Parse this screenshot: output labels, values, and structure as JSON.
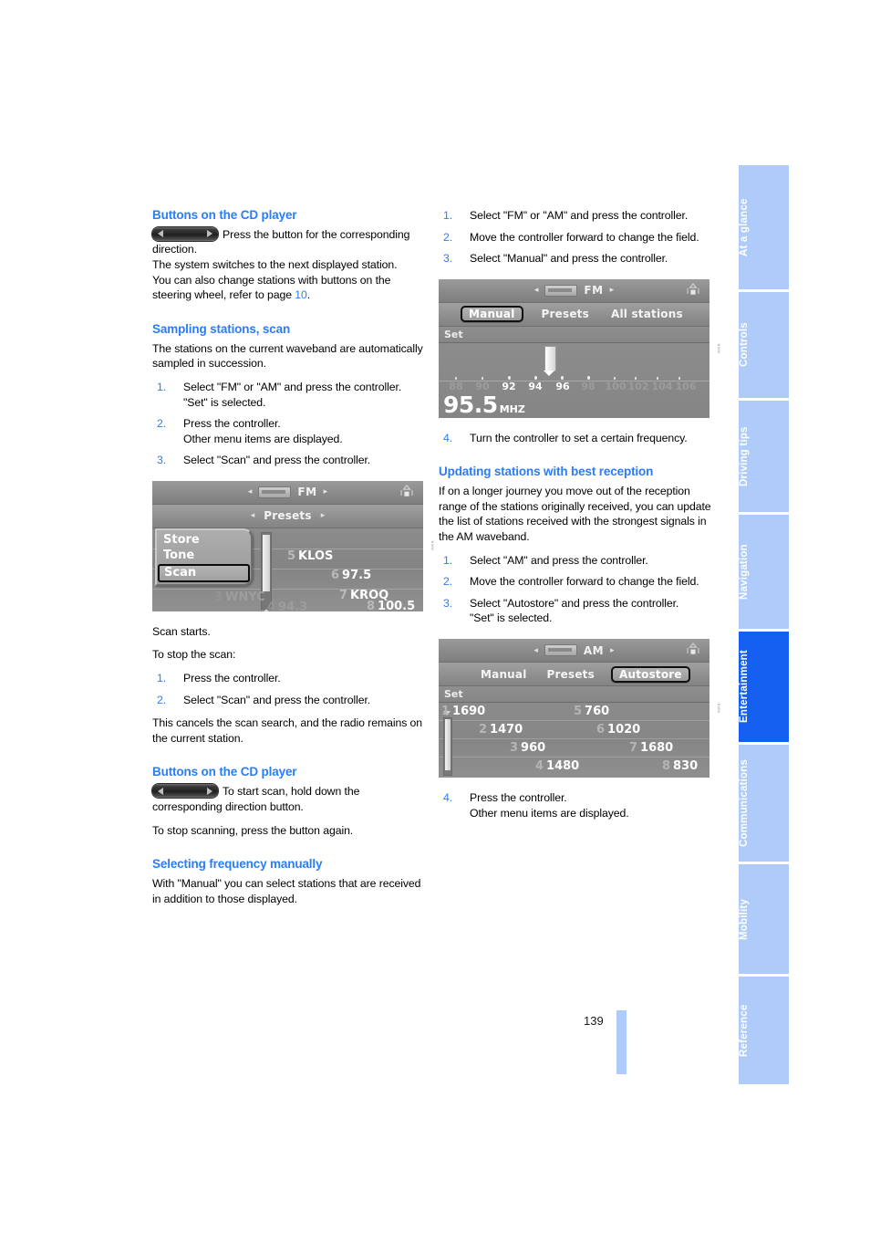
{
  "page": {
    "number": "139",
    "accent_blue": "#2b7df6",
    "tab_blue": "#aecbfa",
    "tab_active_blue": "#1560f0"
  },
  "left_column": {
    "sections": [
      {
        "heading": "Buttons on the CD player",
        "icon": "rocker-button-icon",
        "icon_text": "Press the button for the corresponding direction.",
        "paragraphs": [
          "The system switches to the next displayed station.",
          "You can also change stations with buttons on the steering wheel, refer to page "
        ],
        "page_ref": "10",
        "page_ref_suffix": "."
      },
      {
        "heading": "Sampling stations, scan",
        "intro": "The stations on the current waveband are automatically sampled in succession.",
        "steps": [
          {
            "num": "1.",
            "text": "Select \"FM\" or \"AM\" and press the controller.",
            "sub": "\"Set\" is selected."
          },
          {
            "num": "2.",
            "text": "Press the controller.",
            "sub": "Other menu items are displayed."
          },
          {
            "num": "3.",
            "text": "Select \"Scan\" and press the controller.",
            "sub": ""
          }
        ],
        "after": [
          "Scan starts.",
          "To stop the scan:"
        ],
        "steps2": [
          {
            "num": "1.",
            "text": "Press the controller.",
            "sub": ""
          },
          {
            "num": "2.",
            "text": "Select \"Scan\" and press the controller.",
            "sub": ""
          }
        ],
        "closing": "This cancels the scan search, and the radio remains on the current station."
      },
      {
        "heading": "Buttons on the CD player",
        "icon": "rocker-button-icon",
        "icon_text": "To start scan, hold down the corresponding direction button.",
        "paragraphs": [
          "To stop scanning, press the button again."
        ]
      },
      {
        "heading": "Selecting frequency manually",
        "intro": "With \"Manual\" you can select stations that are received in addition to those displayed."
      }
    ]
  },
  "right_column": {
    "manual_steps": [
      {
        "num": "1.",
        "text": "Select \"FM\" or \"AM\" and press the controller.",
        "sub": ""
      },
      {
        "num": "2.",
        "text": "Move the controller forward to change the field.",
        "sub": ""
      },
      {
        "num": "3.",
        "text": "Select \"Manual\" and press the controller.",
        "sub": ""
      }
    ],
    "manual_step4": {
      "num": "4.",
      "text": "Turn the controller to set a certain frequency.",
      "sub": ""
    },
    "autostore_section": {
      "heading": "Updating stations with best reception",
      "intro": "If on a longer journey you move out of the reception range of the stations originally received, you can update the list of stations received with the strongest signals in the AM waveband.",
      "steps": [
        {
          "num": "1.",
          "text": "Select \"AM\" and press the controller.",
          "sub": ""
        },
        {
          "num": "2.",
          "text": "Move the controller forward to change the field.",
          "sub": ""
        },
        {
          "num": "3.",
          "text": "Select \"Autostore\" and press the controller.",
          "sub": "\"Set\" is selected."
        }
      ],
      "step4": {
        "num": "4.",
        "text": "Press the controller.",
        "sub": "Other menu items are displayed."
      }
    }
  },
  "radio_shot_presets": {
    "band": "FM",
    "nav_row": "Presets",
    "arrow_left": "◂",
    "arrow_right": "▸",
    "popup_items": [
      {
        "label": "Store",
        "selected": false
      },
      {
        "label": "Tone",
        "selected": false
      },
      {
        "label": "Scan",
        "selected": true
      }
    ],
    "presets": [
      {
        "num": "3",
        "name": "WNYC",
        "dim": true
      },
      {
        "num": "4",
        "name": "94.3",
        "dim": true
      },
      {
        "num": "5",
        "name": "KLOS",
        "dim": false
      },
      {
        "num": "6",
        "name": "97.5",
        "dim": false
      },
      {
        "num": "7",
        "name": "KROQ",
        "dim": false
      },
      {
        "num": "8",
        "name": "100.5",
        "dim": false
      }
    ]
  },
  "radio_shot_manual": {
    "band": "FM",
    "menu": [
      {
        "label": "Manual",
        "selected": true
      },
      {
        "label": "Presets",
        "selected": false
      },
      {
        "label": "All stations",
        "selected": false
      }
    ],
    "set_label": "Set",
    "scale_labels": [
      "88",
      "90",
      "92",
      "94",
      "96",
      "98",
      "100",
      "102",
      "104",
      "106"
    ],
    "bright_labels": [
      "92",
      "94",
      "96",
      "98"
    ],
    "frequency": "95.5",
    "unit": "MHZ"
  },
  "radio_shot_autostore": {
    "band": "AM",
    "menu": [
      {
        "label": "Manual",
        "selected": false
      },
      {
        "label": "Presets",
        "selected": false
      },
      {
        "label": "Autostore",
        "selected": true
      }
    ],
    "set_label": "Set",
    "presets_left": [
      {
        "num": "1",
        "name": "1690"
      },
      {
        "num": "2",
        "name": "1470"
      },
      {
        "num": "3",
        "name": "960"
      },
      {
        "num": "4",
        "name": "1480"
      }
    ],
    "presets_right": [
      {
        "num": "5",
        "name": "760"
      },
      {
        "num": "6",
        "name": "1020"
      },
      {
        "num": "7",
        "name": "1680"
      },
      {
        "num": "8",
        "name": "830"
      }
    ]
  },
  "tabs": [
    {
      "label": "At a glance",
      "active": false
    },
    {
      "label": "Controls",
      "active": false
    },
    {
      "label": "Driving tips",
      "active": false
    },
    {
      "label": "Navigation",
      "active": false
    },
    {
      "label": "Entertainment",
      "active": true
    },
    {
      "label": "Communications",
      "active": false
    },
    {
      "label": "Mobility",
      "active": false
    },
    {
      "label": "Reference",
      "active": false
    }
  ]
}
